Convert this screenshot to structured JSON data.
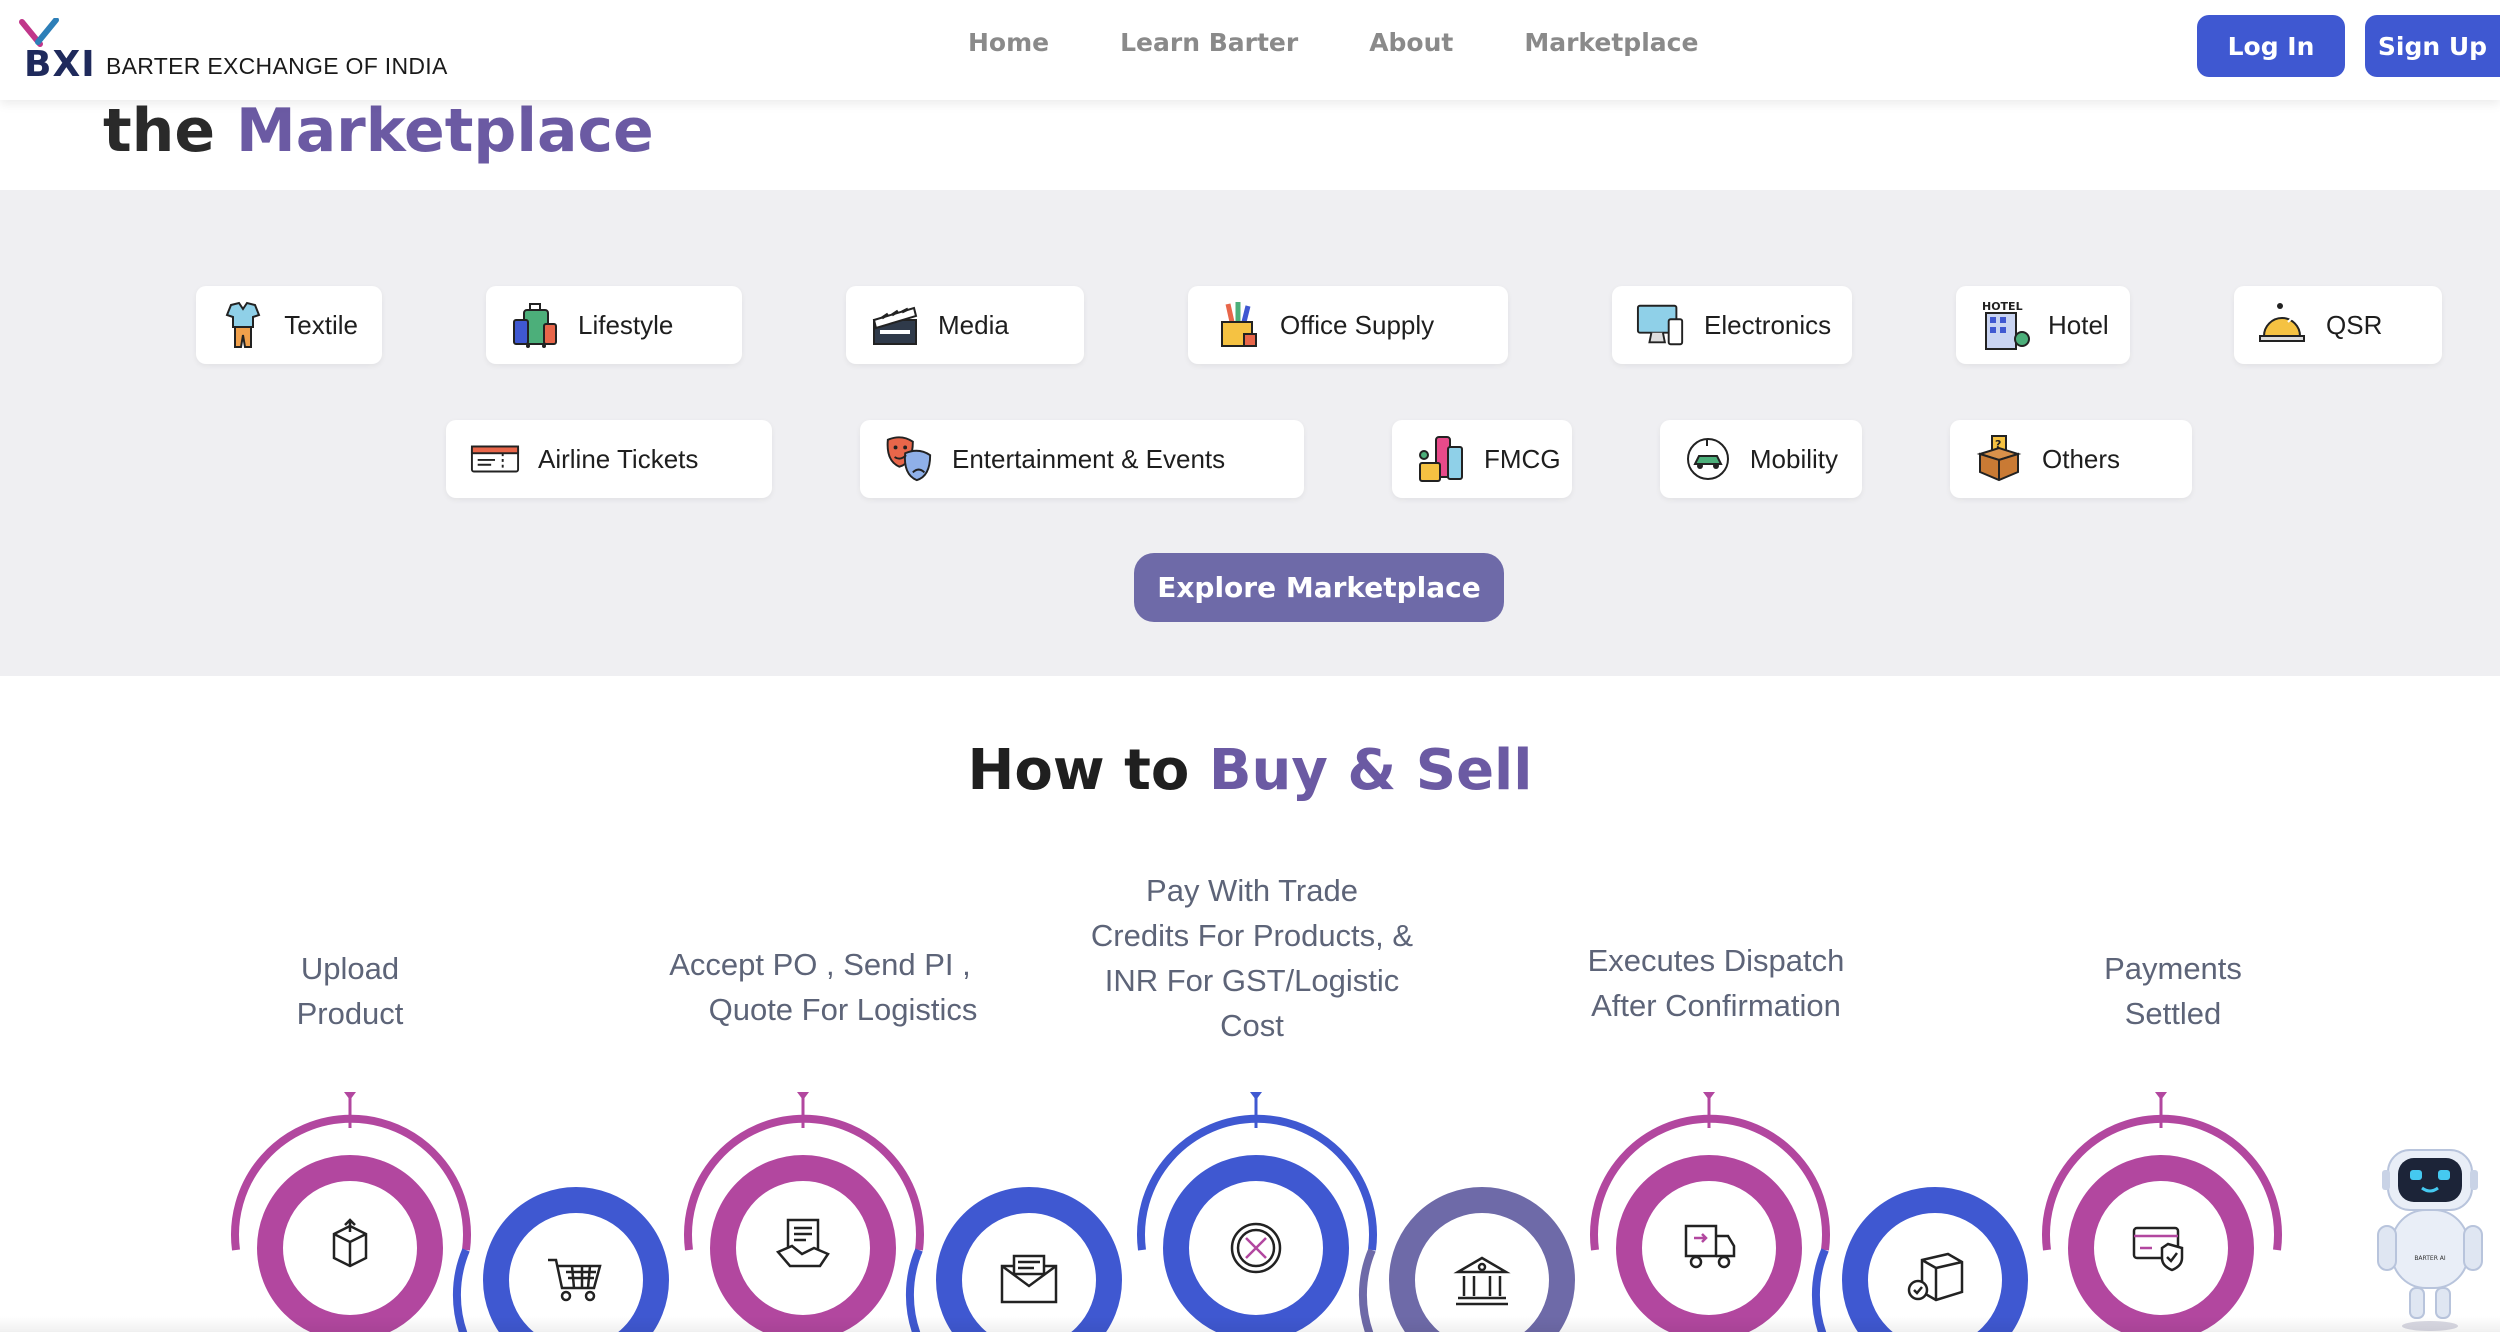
{
  "header": {
    "logo_mark": "BXI",
    "logo_text": "BARTER EXCHANGE OF INDIA",
    "nav": [
      "Home",
      "Learn Barter",
      "About",
      "Marketplace"
    ],
    "login_label": "Log In",
    "signup_label": "Sign Up",
    "accent_color": "#3f58d1"
  },
  "hero": {
    "title_prefix": "the",
    "title_accent": "Marketplace"
  },
  "categories": {
    "row1": [
      {
        "label": "Textile",
        "icon": "clothes-icon"
      },
      {
        "label": "Lifestyle",
        "icon": "luggage-icon"
      },
      {
        "label": "Media",
        "icon": "clapperboard-icon"
      },
      {
        "label": "Office Supply",
        "icon": "pencil-holder-icon"
      },
      {
        "label": "Electronics",
        "icon": "monitor-icon"
      },
      {
        "label": "Hotel",
        "icon": "hotel-building-icon"
      },
      {
        "label": "QSR",
        "icon": "serving-cloche-icon"
      }
    ],
    "row2": [
      {
        "label": "Airline Tickets",
        "icon": "ticket-icon"
      },
      {
        "label": "Entertainment & Events",
        "icon": "theatre-masks-icon"
      },
      {
        "label": "FMCG",
        "icon": "grocery-icon"
      },
      {
        "label": "Mobility",
        "icon": "electric-car-icon"
      },
      {
        "label": "Others",
        "icon": "open-box-icon"
      }
    ],
    "explore_label": "Explore Marketplace",
    "band_color": "#efeff2",
    "explore_color": "#6e6aa8"
  },
  "how_to": {
    "title_prefix": "How to",
    "title_accent": "Buy & Sell",
    "steps": [
      {
        "lines": [
          "Upload",
          "Product"
        ]
      },
      {
        "lines": [
          "Accept PO , Send PI ,",
          "Quote For Logistics"
        ]
      },
      {
        "lines": [
          "Pay With Trade",
          "Credits For Products, &",
          "INR For GST/Logistic",
          "Cost"
        ]
      },
      {
        "lines": [
          "Executes Dispatch",
          "After Confirmation"
        ]
      },
      {
        "lines": [
          "Payments",
          "Settled"
        ]
      }
    ],
    "ring_icons": [
      "upload-box-icon",
      "shopping-cart-icon",
      "handshake-document-icon",
      "invoice-envelope-icon",
      "trade-coin-icon",
      "bank-icon",
      "delivery-truck-icon",
      "package-check-icon",
      "card-shield-icon"
    ],
    "colors": {
      "magenta": "#b2479f",
      "blue": "#3f58d1",
      "slate": "#6e6aa8"
    }
  },
  "robot": {
    "badge": "BARTER AI"
  }
}
